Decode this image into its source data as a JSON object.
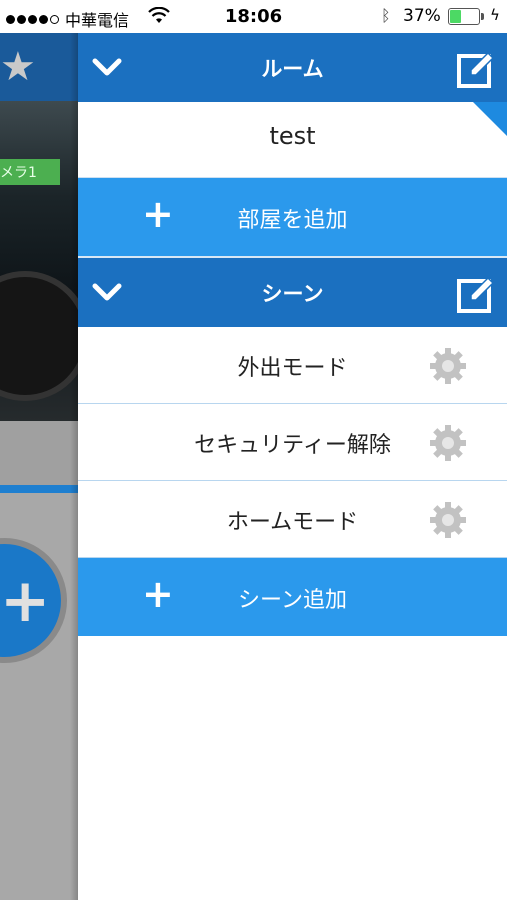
{
  "status_bar": {
    "carrier": "中華電信",
    "time": "18:06",
    "battery_percent": "37%",
    "battery_level": 0.37,
    "battery_color": "#4cd964"
  },
  "background_app": {
    "camera_label": "メラ1",
    "star_icon": "star-icon"
  },
  "drawer": {
    "rooms": {
      "title": "ルーム",
      "items": [
        {
          "label": "test"
        }
      ],
      "add_label": "部屋を追加"
    },
    "scenes": {
      "title": "シーン",
      "items": [
        {
          "label": "外出モード"
        },
        {
          "label": "セキュリティー解除"
        },
        {
          "label": "ホームモード"
        }
      ],
      "add_label": "シーン追加"
    }
  },
  "colors": {
    "header_blue": "#1b70c0",
    "add_row_blue": "#2b99ec",
    "gear_gray": "#c2c2c2"
  }
}
